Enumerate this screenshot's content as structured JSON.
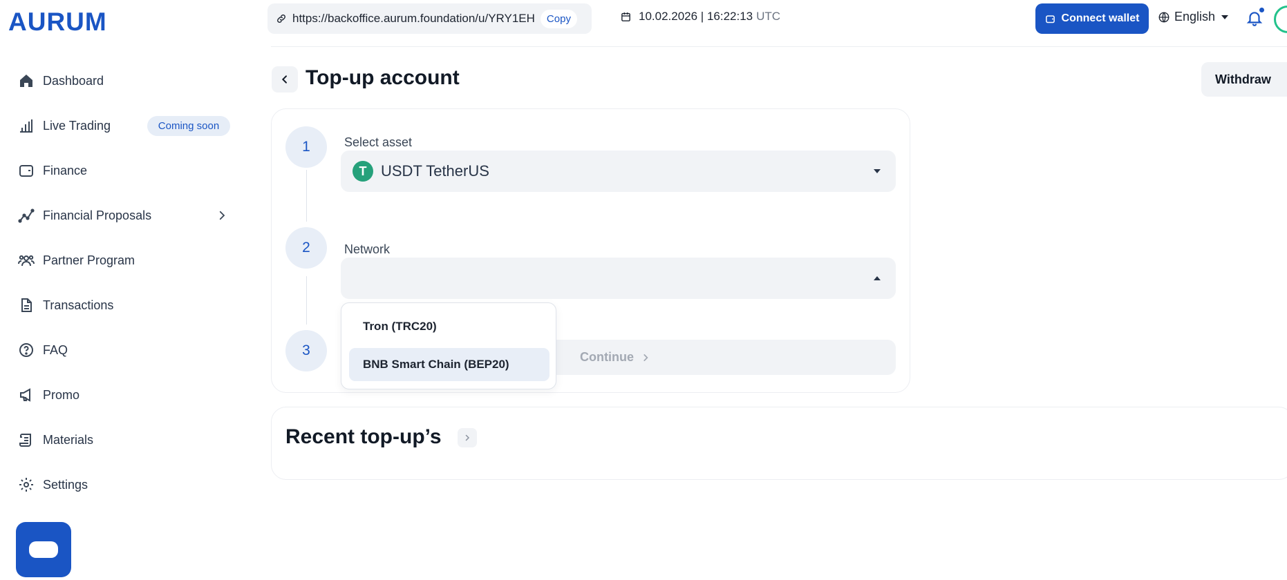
{
  "header": {
    "logo": "AURUM",
    "url": "https://backoffice.aurum.foundation/u/YRY1EH",
    "copy_label": "Copy",
    "date_time": "10.02.2026 | 16:22:13",
    "timezone": "UTC",
    "connect_wallet_label": "Connect wallet",
    "language": "English"
  },
  "sidebar": {
    "items": [
      {
        "label": "Dashboard",
        "icon": "home-icon"
      },
      {
        "label": "Live Trading",
        "icon": "bar-chart-icon",
        "badge": "Coming soon"
      },
      {
        "label": "Finance",
        "icon": "wallet-icon"
      },
      {
        "label": "Financial Proposals",
        "icon": "trend-icon"
      },
      {
        "label": "Partner Program",
        "icon": "users-icon"
      },
      {
        "label": "Transactions",
        "icon": "document-icon"
      },
      {
        "label": "FAQ",
        "icon": "question-icon"
      },
      {
        "label": "Promo",
        "icon": "megaphone-icon"
      },
      {
        "label": "Materials",
        "icon": "scroll-icon"
      },
      {
        "label": "Settings",
        "icon": "gear-icon"
      }
    ]
  },
  "main": {
    "title": "Top-up account",
    "withdraw_label": "Withdraw",
    "steps": [
      "1",
      "2",
      "3"
    ],
    "asset_label": "Select asset",
    "asset_value": "USDT TetherUS",
    "asset_icon_glyph": "T",
    "network_label": "Network",
    "network_value": "",
    "network_options": [
      "Tron (TRC20)",
      "BNB Smart Chain (BEP20)"
    ],
    "continue_label": "Continue",
    "recent_title": "Recent top-up’s"
  },
  "colors": {
    "brand": "#1a55c4",
    "tether": "#26a17b",
    "avatar_ring": "#22c28b"
  }
}
